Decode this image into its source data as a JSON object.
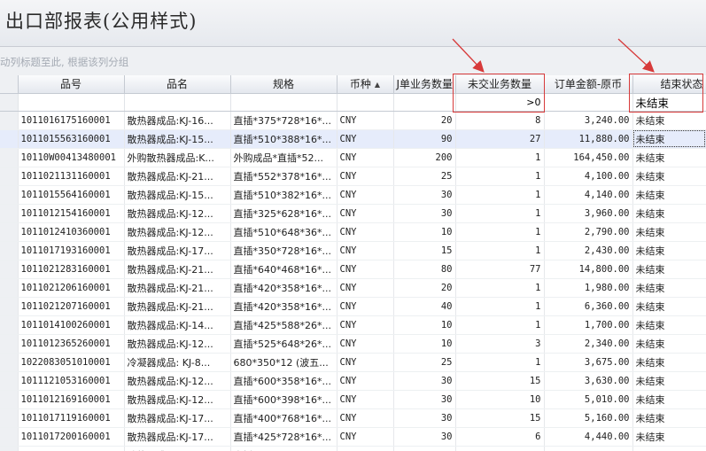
{
  "window": {
    "title": "出口部报表(公用样式)"
  },
  "group_hint": "动列标题至此, 根据该列分组",
  "columns": [
    {
      "key": "rowhdr",
      "label": ""
    },
    {
      "key": "code",
      "label": "品号"
    },
    {
      "key": "name",
      "label": "品名"
    },
    {
      "key": "spec",
      "label": "规格"
    },
    {
      "key": "currency",
      "label": "币种"
    },
    {
      "key": "order_qty",
      "label": "J单业务数量"
    },
    {
      "key": "open_qty",
      "label": "未交业务数量"
    },
    {
      "key": "amount",
      "label": "订单金额-原币"
    },
    {
      "key": "status",
      "label": "结束状态"
    }
  ],
  "filters": {
    "open_qty": ">0",
    "status": "未结束"
  },
  "rows": [
    {
      "code": "1011016175160001",
      "name": "散热器成品:KJ-16...",
      "spec": "直插*375*728*16*...",
      "currency": "CNY",
      "order_qty": "20",
      "open_qty": "8",
      "amount": "3,240.00",
      "status": "未结束"
    },
    {
      "code": "1011015563160001",
      "name": "散热器成品:KJ-15...",
      "spec": "直插*510*388*16*...",
      "currency": "CNY",
      "order_qty": "90",
      "open_qty": "27",
      "amount": "11,880.00",
      "status": "未结束"
    },
    {
      "code": "10110W00413480001",
      "name": "外购散热器成品:K...",
      "spec": "外购成品*直插*52...",
      "currency": "CNY",
      "order_qty": "200",
      "open_qty": "1",
      "amount": "164,450.00",
      "status": "未结束"
    },
    {
      "code": "1011021131160001",
      "name": "散热器成品:KJ-21...",
      "spec": "直插*552*378*16*...",
      "currency": "CNY",
      "order_qty": "25",
      "open_qty": "1",
      "amount": "4,100.00",
      "status": "未结束"
    },
    {
      "code": "1011015564160001",
      "name": "散热器成品:KJ-15...",
      "spec": "直插*510*382*16*...",
      "currency": "CNY",
      "order_qty": "30",
      "open_qty": "1",
      "amount": "4,140.00",
      "status": "未结束"
    },
    {
      "code": "1011012154160001",
      "name": "散热器成品:KJ-12...",
      "spec": "直插*325*628*16*...",
      "currency": "CNY",
      "order_qty": "30",
      "open_qty": "1",
      "amount": "3,960.00",
      "status": "未结束"
    },
    {
      "code": "1011012410360001",
      "name": "散热器成品:KJ-12...",
      "spec": "直插*510*648*36*...",
      "currency": "CNY",
      "order_qty": "10",
      "open_qty": "1",
      "amount": "2,790.00",
      "status": "未结束"
    },
    {
      "code": "1011017193160001",
      "name": "散热器成品:KJ-17...",
      "spec": "直插*350*728*16*...",
      "currency": "CNY",
      "order_qty": "15",
      "open_qty": "1",
      "amount": "2,430.00",
      "status": "未结束"
    },
    {
      "code": "1011021283160001",
      "name": "散热器成品:KJ-21...",
      "spec": "直插*640*468*16*...",
      "currency": "CNY",
      "order_qty": "80",
      "open_qty": "77",
      "amount": "14,800.00",
      "status": "未结束"
    },
    {
      "code": "1011021206160001",
      "name": "散热器成品:KJ-21...",
      "spec": "直插*420*358*16*...",
      "currency": "CNY",
      "order_qty": "20",
      "open_qty": "1",
      "amount": "1,980.00",
      "status": "未结束"
    },
    {
      "code": "1011021207160001",
      "name": "散热器成品:KJ-21...",
      "spec": "直插*420*358*16*...",
      "currency": "CNY",
      "order_qty": "40",
      "open_qty": "1",
      "amount": "6,360.00",
      "status": "未结束"
    },
    {
      "code": "1011014100260001",
      "name": "散热器成品:KJ-14...",
      "spec": "直插*425*588*26*...",
      "currency": "CNY",
      "order_qty": "10",
      "open_qty": "1",
      "amount": "1,700.00",
      "status": "未结束"
    },
    {
      "code": "1011012365260001",
      "name": "散热器成品:KJ-12...",
      "spec": "直插*525*648*26*...",
      "currency": "CNY",
      "order_qty": "10",
      "open_qty": "3",
      "amount": "2,340.00",
      "status": "未结束"
    },
    {
      "code": "1022083051010001",
      "name": "冷凝器成品: KJ-8...",
      "spec": "680*350*12 (波五...",
      "currency": "CNY",
      "order_qty": "25",
      "open_qty": "1",
      "amount": "3,675.00",
      "status": "未结束"
    },
    {
      "code": "1011121053160001",
      "name": "散热器成品:KJ-12...",
      "spec": "直插*600*358*16*...",
      "currency": "CNY",
      "order_qty": "30",
      "open_qty": "15",
      "amount": "3,630.00",
      "status": "未结束"
    },
    {
      "code": "1011012169160001",
      "name": "散热器成品:KJ-12...",
      "spec": "直插*600*398*16*...",
      "currency": "CNY",
      "order_qty": "30",
      "open_qty": "10",
      "amount": "5,010.00",
      "status": "未结束"
    },
    {
      "code": "1011017119160001",
      "name": "散热器成品:KJ-17...",
      "spec": "直插*400*768*16*...",
      "currency": "CNY",
      "order_qty": "30",
      "open_qty": "15",
      "amount": "5,160.00",
      "status": "未结束"
    },
    {
      "code": "1011017200160001",
      "name": "散热器成品:KJ-17...",
      "spec": "直插*425*728*16*...",
      "currency": "CNY",
      "order_qty": "30",
      "open_qty": "6",
      "amount": "4,440.00",
      "status": "未结束"
    },
    {
      "code": "",
      "name": "散热器成品...",
      "spec": "直插...",
      "currency": "",
      "order_qty": "",
      "open_qty": "",
      "amount": "",
      "status": ""
    }
  ],
  "selected_row_index": 1,
  "colors": {
    "highlight": "#d73a3a",
    "selected_row": "#e6ecfb"
  },
  "icons": {
    "sort": "sort-ascending-icon"
  }
}
